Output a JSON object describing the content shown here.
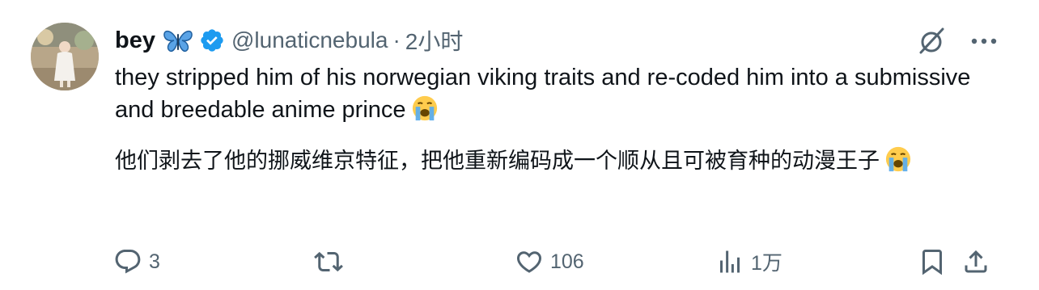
{
  "user": {
    "display_name": "bey",
    "name_emoji": "butterfly-emoji",
    "handle": "@lunaticnebula",
    "separator": "·",
    "time": "2小时",
    "verified": true,
    "verified_color": "#1d9bf0"
  },
  "tweet": {
    "text_en": "they stripped him of his norwegian viking traits and re-coded him into a submissive and breedable anime prince",
    "text_zh": "他们剥去了他的挪威维京特征，把他重新编码成一个顺从且可被育种的动漫王子",
    "trailing_emoji": "loudly-crying-face-emoji"
  },
  "actions": {
    "replies": "3",
    "retweets": "",
    "likes": "106",
    "views": "1万"
  },
  "colors": {
    "text": "#0f1419",
    "secondary": "#536471",
    "accent": "#1d9bf0",
    "background": "#ffffff"
  },
  "icons": [
    "grok-icon",
    "more-icon",
    "reply-icon",
    "retweet-icon",
    "like-icon",
    "views-icon",
    "bookmark-icon",
    "share-icon"
  ]
}
